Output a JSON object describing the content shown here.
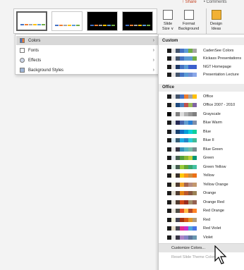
{
  "ribbon": {
    "top_strip": [
      "↑ Share",
      "• Comments"
    ],
    "buttons": [
      {
        "line1": "Slide",
        "line2": "Size ∨"
      },
      {
        "line1": "Format",
        "line2": "Background"
      },
      {
        "line1": "Design",
        "line2": "Ideas"
      }
    ]
  },
  "menu": {
    "items": [
      {
        "label": "Colors",
        "icon": "colors-icon",
        "has_submenu": true,
        "active": true
      },
      {
        "label": "Fonts",
        "icon": "fonts-icon",
        "has_submenu": true,
        "active": false
      },
      {
        "label": "Effects",
        "icon": "effects-icon",
        "has_submenu": true,
        "active": false
      },
      {
        "label": "Background Styles",
        "icon": "background-styles-icon",
        "has_submenu": true,
        "active": false
      }
    ]
  },
  "colors_submenu": {
    "custom_header": "Custom",
    "custom": [
      {
        "name": "CadenSee Colors",
        "colors": [
          "#ffffff",
          "#1a1a1a",
          "#e7e6e6",
          "#44546a",
          "#4472c4",
          "#5b9bd5",
          "#70ad47",
          "#a5a5a5"
        ]
      },
      {
        "name": "Kickass Presentations",
        "colors": [
          "#ffffff",
          "#1a1a1a",
          "#e7e6e6",
          "#44546a",
          "#4472c4",
          "#5b9bd5",
          "#5b9bd5",
          "#70ad47"
        ]
      },
      {
        "name": "NGT Homepage",
        "colors": [
          "#ffffff",
          "#1a1a1a",
          "#e7e6e6",
          "#1f3864",
          "#4472c4",
          "#5b9bd5",
          "#3a5fcd",
          "#3a5fcd"
        ]
      },
      {
        "name": "Presentation Lecture",
        "colors": [
          "#ffffff",
          "#1a1a1a",
          "#e7e6e6",
          "#44546a",
          "#4472c4",
          "#5b9bd5",
          "#6f8fd6",
          "#8aa7e8"
        ]
      }
    ],
    "office_header": "Office",
    "office": [
      {
        "name": "Office",
        "colors": [
          "#ffffff",
          "#1a1a1a",
          "#e7e6e6",
          "#44546a",
          "#4472c4",
          "#ed7d31",
          "#a5a5a5",
          "#ffc000"
        ]
      },
      {
        "name": "Office 2007 - 2010",
        "colors": [
          "#ffffff",
          "#1a1a1a",
          "#eeece1",
          "#1f497d",
          "#4f81bd",
          "#c0504d",
          "#9bbb59",
          "#8064a2"
        ]
      },
      {
        "name": "Grayscale",
        "colors": [
          "#ffffff",
          "#000000",
          "#f2f2f2",
          "#7f7f7f",
          "#dddddd",
          "#b2b2b2",
          "#969696",
          "#808080"
        ]
      },
      {
        "name": "Blue Warm",
        "colors": [
          "#ffffff",
          "#1a1a1a",
          "#dfe3e5",
          "#242852",
          "#4a66ac",
          "#629dd1",
          "#297fd5",
          "#7f8fa9"
        ]
      },
      {
        "name": "Blue",
        "colors": [
          "#ffffff",
          "#1a1a1a",
          "#dee6ef",
          "#17406d",
          "#0f6fc6",
          "#009dd9",
          "#0bd0d9",
          "#10cf9b"
        ]
      },
      {
        "name": "Blue II",
        "colors": [
          "#ffffff",
          "#1a1a1a",
          "#dbeff9",
          "#335b74",
          "#1cade4",
          "#2683c6",
          "#27ced7",
          "#42ba97"
        ]
      },
      {
        "name": "Blue Green",
        "colors": [
          "#ffffff",
          "#1a1a1a",
          "#ebebeb",
          "#373545",
          "#3494ba",
          "#58b6c0",
          "#75bda7",
          "#7a8c8e"
        ]
      },
      {
        "name": "Green",
        "colors": [
          "#ffffff",
          "#1a1a1a",
          "#e4e9ef",
          "#455f51",
          "#549e39",
          "#8ab833",
          "#c0cf3a",
          "#029676"
        ]
      },
      {
        "name": "Green Yellow",
        "colors": [
          "#ffffff",
          "#1a1a1a",
          "#dbefe4",
          "#455f51",
          "#99cb38",
          "#63a537",
          "#37a76f",
          "#44c1a3"
        ]
      },
      {
        "name": "Yellow",
        "colors": [
          "#ffffff",
          "#1a1a1a",
          "#fef8e3",
          "#39302a",
          "#ffca08",
          "#f8931d",
          "#ce8d3e",
          "#ec7016"
        ]
      },
      {
        "name": "Yellow Orange",
        "colors": [
          "#ffffff",
          "#1a1a1a",
          "#f3f2dc",
          "#4e3b30",
          "#f0a22e",
          "#a5644e",
          "#b58b80",
          "#c3986d"
        ]
      },
      {
        "name": "Orange",
        "colors": [
          "#ffffff",
          "#1a1a1a",
          "#e3ded1",
          "#4e3b30",
          "#e48312",
          "#bd582c",
          "#865640",
          "#9b8357"
        ]
      },
      {
        "name": "Orange Red",
        "colors": [
          "#ffffff",
          "#1a1a1a",
          "#e9e5dc",
          "#4e3b30",
          "#d34817",
          "#9b2d1f",
          "#a28e6a",
          "#956251"
        ]
      },
      {
        "name": "Red Orange",
        "colors": [
          "#ffffff",
          "#1a1a1a",
          "#e9e5dc",
          "#505046",
          "#e84c22",
          "#ffbd47",
          "#b64926",
          "#ff8427"
        ]
      },
      {
        "name": "Red",
        "colors": [
          "#ffffff",
          "#1a1a1a",
          "#f3f2dc",
          "#454551",
          "#a5300f",
          "#d55816",
          "#e19825",
          "#b19c7d"
        ]
      },
      {
        "name": "Red Violet",
        "colors": [
          "#ffffff",
          "#1a1a1a",
          "#e7dec9",
          "#454551",
          "#e32d91",
          "#c830cc",
          "#4ea6dc",
          "#4775e7"
        ]
      },
      {
        "name": "Violet",
        "colors": [
          "#ffffff",
          "#1a1a1a",
          "#eaeaea",
          "#373545",
          "#ad84c6",
          "#8784c7",
          "#5d739a",
          "#6997af"
        ]
      }
    ],
    "customize_label": "Customize Colors...",
    "reset_label": "Reset Slide Theme Colors"
  }
}
